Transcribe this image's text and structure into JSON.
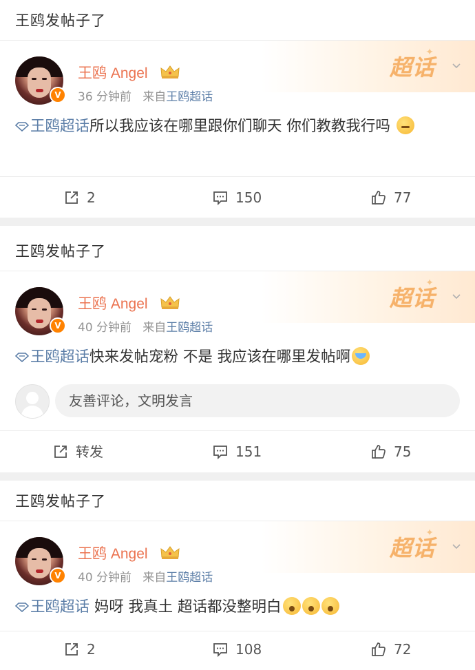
{
  "colors": {
    "username": "#eb7350",
    "link": "#5d7fa8",
    "badge": "#ff8200",
    "separator": "#f0f0f0"
  },
  "posts": [
    {
      "group_title": "王鸥发帖子了",
      "badge": "超话",
      "username": "王鸥 Angel",
      "time": "36 分钟前",
      "source_prefix": "来自",
      "source": "王鸥超话",
      "topic": "王鸥超话",
      "text": "所以我应该在哪里跟你们聊天 你们教教我行吗",
      "emojis": [
        "sweat"
      ],
      "actions": {
        "repost": "2",
        "comment": "150",
        "like": "77"
      }
    },
    {
      "group_title": "王鸥发帖子了",
      "badge": "超话",
      "username": "王鸥 Angel",
      "time": "40 分钟前",
      "source_prefix": "来自",
      "source": "王鸥超话",
      "topic": "王鸥超话",
      "text": "快来发帖宠粉 不是 我应该在哪里发帖啊",
      "emojis": [
        "cry"
      ],
      "comment_placeholder": "友善评论，文明发言",
      "actions": {
        "repost": "转发",
        "comment": "151",
        "like": "75"
      }
    },
    {
      "group_title": "王鸥发帖子了",
      "badge": "超话",
      "username": "王鸥 Angel",
      "time": "40 分钟前",
      "source_prefix": "来自",
      "source": "王鸥超话",
      "topic": "王鸥超话",
      "text": " 妈呀 我真土 超话都没整明白",
      "emojis": [
        "scared",
        "scared",
        "scared"
      ],
      "actions": {
        "repost": "2",
        "comment": "108",
        "like": "72"
      }
    }
  ],
  "icons": {
    "topic": "diamond-topic-icon",
    "chevron": "chevron-down-icon",
    "repost": "share-icon",
    "comment": "comment-icon",
    "like": "thumb-up-icon",
    "crown": "crown-icon",
    "verified": "verified-v-icon"
  }
}
